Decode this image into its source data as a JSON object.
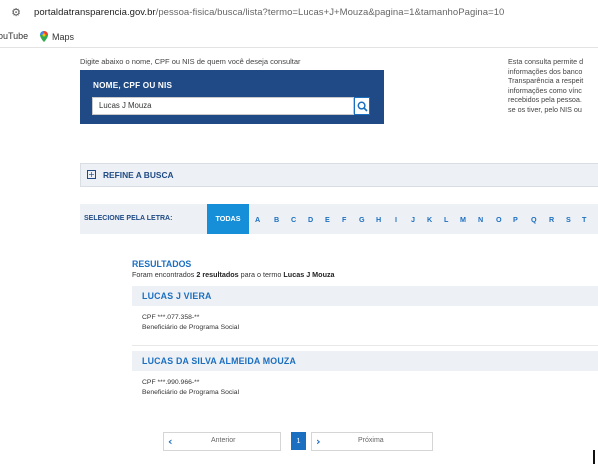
{
  "browser": {
    "url_host": "portaldatransparencia.gov.br",
    "url_path": "/pessoa-fisica/busca/lista?termo=Lucas+J+Mouza&pagina=1&tamanhoPagina=10",
    "bookmarks": [
      "ouTube",
      "Maps"
    ]
  },
  "search": {
    "intro": "Digite abaixo o nome, CPF ou NIS de quem você deseja consultar",
    "label": "NOME, CPF OU NIS",
    "value": "Lucas J Mouza"
  },
  "side_note": [
    "Esta consulta permite d",
    "informações dos banco",
    "Transparência a respeit",
    "informações como vínc",
    "recebidos pela pessoa.",
    "se os tiver, pelo NIS ou"
  ],
  "refine": {
    "label": "REFINE A BUSCA"
  },
  "letters": {
    "label": "SELECIONE PELA LETRA:",
    "all": "TODAS",
    "items": [
      "A",
      "B",
      "C",
      "D",
      "E",
      "F",
      "G",
      "H",
      "I",
      "J",
      "K",
      "L",
      "M",
      "N",
      "O",
      "P",
      "Q",
      "R",
      "S",
      "T"
    ]
  },
  "results": {
    "title": "RESULTADOS",
    "count_prefix": "Foram encontrados ",
    "count_value": "2 resultados",
    "count_middle": " para o termo ",
    "count_term": "Lucas J Mouza",
    "items": [
      {
        "name": "LUCAS J VIERA",
        "cpf": "CPF ***.077.358-**",
        "type": "Beneficiário de Programa Social"
      },
      {
        "name": "LUCAS DA SILVA ALMEIDA MOUZA",
        "cpf": "CPF ***.990.966-**",
        "type": "Beneficiário de Programa Social"
      }
    ]
  },
  "pagination": {
    "prev": "Anterior",
    "current": "1",
    "next": "Próxima"
  }
}
